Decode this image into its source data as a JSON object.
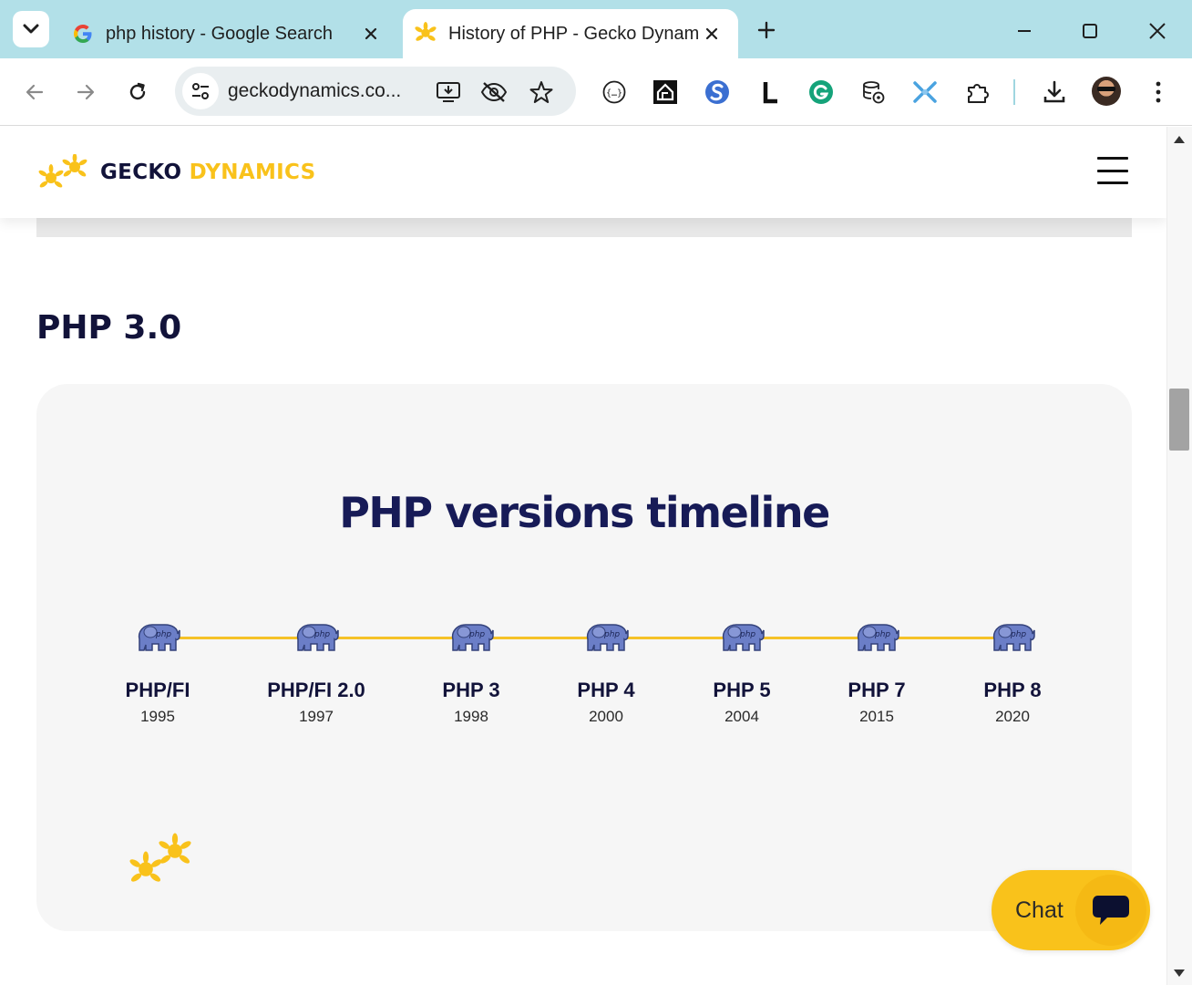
{
  "browser": {
    "tabs": [
      {
        "title": "php history - Google Search",
        "favicon": "google-g-icon",
        "active": false
      },
      {
        "title": "History of PHP - Gecko Dynamic",
        "favicon": "gecko-icon",
        "active": true
      }
    ],
    "address_bar": {
      "url": "geckodynamics.co..."
    }
  },
  "site": {
    "logo": {
      "word1": "GECKO",
      "word2": "DYNAMICS"
    },
    "section_heading": "PHP 3.0",
    "timeline": {
      "title": "PHP versions timeline",
      "versions": [
        {
          "name": "PHP/FI",
          "year": "1995"
        },
        {
          "name": "PHP/FI 2.0",
          "year": "1997"
        },
        {
          "name": "PHP 3",
          "year": "1998"
        },
        {
          "name": "PHP 4",
          "year": "2000"
        },
        {
          "name": "PHP 5",
          "year": "2004"
        },
        {
          "name": "PHP 7",
          "year": "2015"
        },
        {
          "name": "PHP 8",
          "year": "2020"
        }
      ]
    }
  },
  "chat": {
    "label": "Chat"
  },
  "colors": {
    "brand_navy": "#12133a",
    "brand_yellow": "#f9c21b",
    "tab_strip": "#b2e0e8",
    "elephant": "#6b7ec7"
  }
}
